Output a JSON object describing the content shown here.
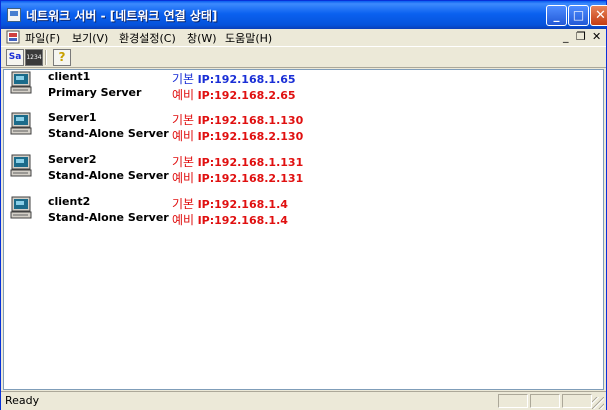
{
  "window": {
    "title": "네트워크 서버 - [네트워크 연결 상태]",
    "caption_buttons": {
      "minimize": "_",
      "maximize": "□",
      "close": "✕"
    }
  },
  "menu": {
    "items": [
      "파일(F)",
      "보기(V)",
      "환경설정(C)",
      "창(W)",
      "도움말(H)"
    ],
    "mdi_controls": {
      "minimize": "_",
      "restore": "❐",
      "close": "✕"
    }
  },
  "toolbar": {
    "buttons": [
      {
        "icon": "server-query-icon",
        "text": "Sa"
      },
      {
        "icon": "ip-config-icon",
        "text": "1234"
      },
      {
        "icon": "help-icon",
        "text": "?"
      }
    ]
  },
  "servers": [
    {
      "name": "client1",
      "role": "Primary Server",
      "primary_label": "기본",
      "primary_ip": "IP:192.168.1.65",
      "primary_color": "#1a2fd6",
      "backup_label": "예비",
      "backup_ip": "IP:192.168.2.65",
      "backup_color": "#e01010"
    },
    {
      "name": "Server1",
      "role": "Stand-Alone Server",
      "primary_label": "기본",
      "primary_ip": "IP:192.168.1.130",
      "primary_color": "#e01010",
      "backup_label": "예비",
      "backup_ip": "IP:192.168.2.130",
      "backup_color": "#e01010"
    },
    {
      "name": "Server2",
      "role": "Stand-Alone Server",
      "primary_label": "기본",
      "primary_ip": "IP:192.168.1.131",
      "primary_color": "#e01010",
      "backup_label": "예비",
      "backup_ip": "IP:192.168.2.131",
      "backup_color": "#e01010"
    },
    {
      "name": "client2",
      "role": "Stand-Alone Server",
      "primary_label": "기본",
      "primary_ip": "IP:192.168.1.4",
      "primary_color": "#e01010",
      "backup_label": "예비",
      "backup_ip": "IP:192.168.1.4",
      "backup_color": "#e01010"
    }
  ],
  "status": {
    "text": "Ready"
  }
}
